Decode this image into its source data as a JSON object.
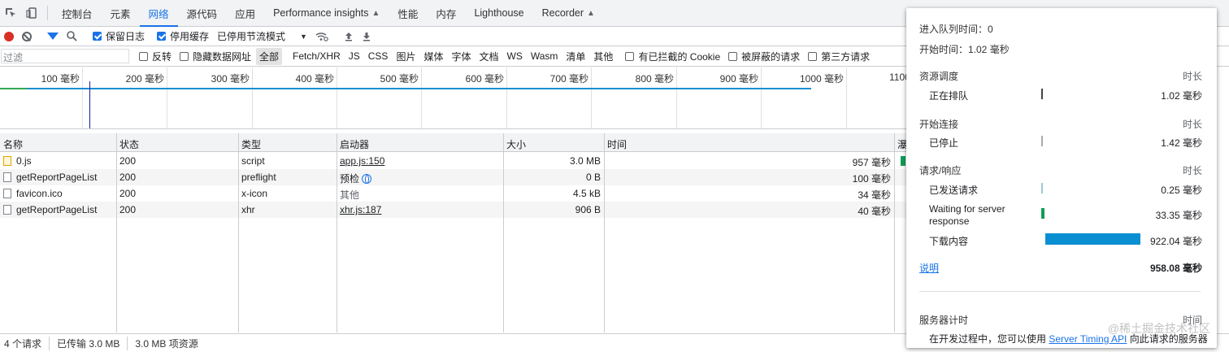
{
  "tabs": [
    {
      "label": "控制台"
    },
    {
      "label": "元素"
    },
    {
      "label": "网络"
    },
    {
      "label": "源代码"
    },
    {
      "label": "应用"
    },
    {
      "label": "Performance insights"
    },
    {
      "label": "性能"
    },
    {
      "label": "内存"
    },
    {
      "label": "Lighthouse"
    },
    {
      "label": "Recorder"
    }
  ],
  "toolbar": {
    "preserve_log": "保留日志",
    "disable_cache": "停用缓存",
    "throttle": "已停用节流模式"
  },
  "filterbar": {
    "placeholder": "过滤",
    "invert": "反转",
    "hide_data_urls": "隐藏数据网址",
    "types": [
      "全部",
      "Fetch/XHR",
      "JS",
      "CSS",
      "图片",
      "媒体",
      "字体",
      "文档",
      "WS",
      "Wasm",
      "清单",
      "其他"
    ],
    "blocked_cookies": "有已拦截的 Cookie",
    "blocked_requests": "被屏蔽的请求",
    "third_party": "第三方请求"
  },
  "overview": {
    "ticks": [
      "100 毫秒",
      "200 毫秒",
      "300 毫秒",
      "400 毫秒",
      "500 毫秒",
      "600 毫秒",
      "700 毫秒",
      "800 毫秒",
      "900 毫秒",
      "1000 毫秒",
      "1100"
    ]
  },
  "table": {
    "headers": {
      "name": "名称",
      "status": "状态",
      "type": "类型",
      "initiator": "启动器",
      "size": "大小",
      "time": "时间",
      "waterfall": "瀑"
    },
    "rows": [
      {
        "name": "0.js",
        "status": "200",
        "type": "script",
        "initiator": "app.js:150",
        "size": "3.0 MB",
        "time": "957 毫秒"
      },
      {
        "name": "getReportPageList",
        "status": "200",
        "type": "preflight",
        "initiator": "预检",
        "size": "0 B",
        "time": "100 毫秒"
      },
      {
        "name": "favicon.ico",
        "status": "200",
        "type": "x-icon",
        "initiator": "其他",
        "size": "4.5 kB",
        "time": "34 毫秒"
      },
      {
        "name": "getReportPageList",
        "status": "200",
        "type": "xhr",
        "initiator": "xhr.js:187",
        "size": "906 B",
        "time": "40 毫秒"
      }
    ]
  },
  "statusbar": {
    "requests": "4 个请求",
    "transferred": "已传输 3.0 MB",
    "resources": "3.0 MB 项资源"
  },
  "popover": {
    "queued_at": "进入队列时间：0",
    "started_at": "开始时间：1.02 毫秒",
    "duration_label": "时长",
    "sections": [
      {
        "title": "资源调度",
        "rows": [
          {
            "label": "正在排队",
            "value": "1.02 毫秒"
          }
        ]
      },
      {
        "title": "开始连接",
        "rows": [
          {
            "label": "已停止",
            "value": "1.42 毫秒"
          }
        ]
      },
      {
        "title": "请求/响应",
        "rows": [
          {
            "label": "已发送请求",
            "value": "0.25 毫秒"
          },
          {
            "label": "Waiting for server",
            "label2": "response",
            "value": "33.35 毫秒"
          },
          {
            "label": "下载内容",
            "value": "922.04 毫秒"
          }
        ]
      }
    ],
    "explain": "说明",
    "total": "958.08 毫秒",
    "server_timing": "服务器计时",
    "server_timing_duration": "时间",
    "server_note_pre": "在开发过程中，您可以使用",
    "server_note_link": "Server Timing API",
    "server_note_post": "向此请求的服务器",
    "watermark": "@稀土掘金技术社区"
  }
}
